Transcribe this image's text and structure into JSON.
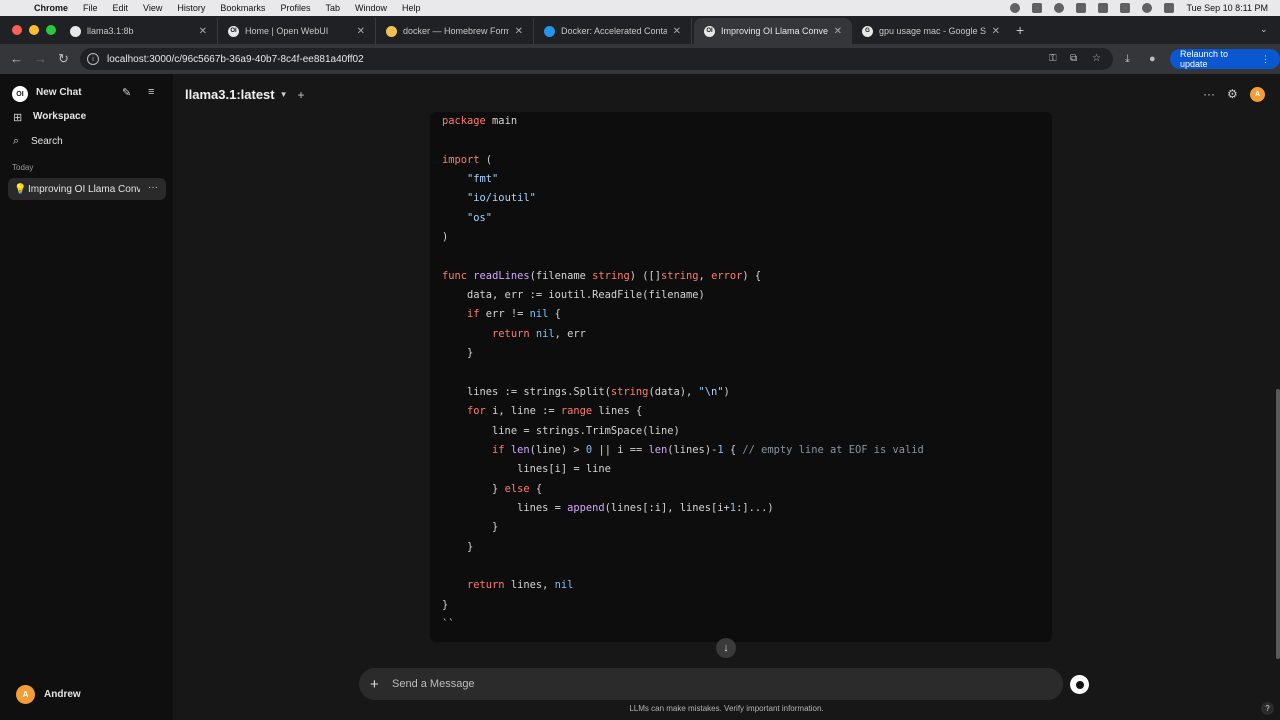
{
  "menubar": {
    "app": "Chrome",
    "items": [
      "File",
      "Edit",
      "View",
      "History",
      "Bookmarks",
      "Profiles",
      "Tab",
      "Window",
      "Help"
    ],
    "clock": "Tue Sep 10  8:11 PM"
  },
  "tabs": [
    {
      "title": "llama3.1:8b",
      "favicon": "github-icon"
    },
    {
      "title": "Home | Open WebUI",
      "favicon": "openwebui-icon"
    },
    {
      "title": "docker — Homebrew Formula",
      "favicon": "homebrew-icon"
    },
    {
      "title": "Docker: Accelerated Containe",
      "favicon": "docker-icon"
    },
    {
      "title": "Improving OI Llama Conve",
      "favicon": "openwebui-icon",
      "active": true
    },
    {
      "title": "gpu usage mac - Google Sear",
      "favicon": "google-icon"
    }
  ],
  "toolbar": {
    "url": "localhost:3000/c/96c5667b-36a9-40b7-8c4f-ee881a40ff02",
    "relaunch_label": "Relaunch to update"
  },
  "sidebar": {
    "new_chat": "New Chat",
    "workspace": "Workspace",
    "search": "Search",
    "section_today": "Today",
    "chats": [
      {
        "title": "Improving OI Llama Conve",
        "icon": "lightbulb-icon"
      }
    ],
    "user_initial": "A",
    "user_name": "Andrew"
  },
  "header": {
    "model": "llama3.1:latest"
  },
  "code": {
    "language": "go",
    "lines": [
      "package main",
      "",
      "import (",
      "    \"fmt\"",
      "    \"io/ioutil\"",
      "    \"os\"",
      ")",
      "",
      "func readLines(filename string) ([]string, error) {",
      "    data, err := ioutil.ReadFile(filename)",
      "    if err != nil {",
      "        return nil, err",
      "    }",
      "",
      "    lines := strings.Split(string(data), \"\\n\")",
      "    for i, line := range lines {",
      "        line = strings.TrimSpace(line)",
      "        if len(line) > 0 || i == len(lines)-1 { // empty line at EOF is valid",
      "            lines[i] = line",
      "        } else {",
      "            lines = append(lines[:i], lines[i+1:]...)",
      "        }",
      "    }",
      "",
      "    return lines, nil",
      "}",
      "``"
    ]
  },
  "composer": {
    "placeholder": "Send a Message",
    "disclaimer": "LLMs can make mistakes. Verify important information.",
    "help": "?"
  },
  "colors": {
    "accent": "#0b57d0",
    "avatar": "#f29d38",
    "keyword": "#ff7b72",
    "function": "#d2a8ff",
    "string": "#a5d6ff",
    "number": "#79c0ff",
    "comment": "#8b949e"
  }
}
